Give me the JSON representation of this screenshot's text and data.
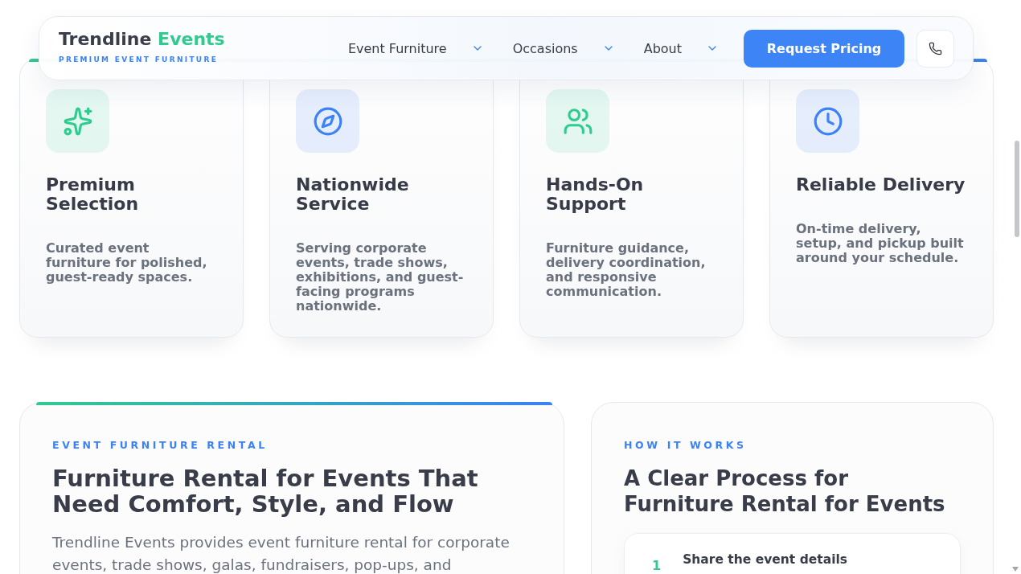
{
  "header": {
    "brand": {
      "name": "Trendline",
      "accent": "Events",
      "tagline": "PREMIUM EVENT FURNITURE"
    },
    "nav": [
      {
        "label": "Event Furniture"
      },
      {
        "label": "Occasions"
      },
      {
        "label": "About"
      }
    ],
    "cta": "Request Pricing"
  },
  "features": [
    {
      "color": "#2ecc8f",
      "title": "Premium Selection",
      "text": "Curated event furniture for polished, guest-ready spaces."
    },
    {
      "color": "#3b82f6",
      "title": "Nationwide Service",
      "text": "Serving corporate events, trade shows, exhibitions, and guest-facing programs nationwide."
    },
    {
      "color": "#2ecc8f",
      "title": "Hands-On Support",
      "text": "Furniture guidance, delivery coordination, and responsive communication."
    },
    {
      "color": "#3b82f6",
      "title": "Reliable Delivery",
      "text": "On-time delivery, setup, and pickup built around your schedule."
    }
  ],
  "intro": {
    "eyebrow": "EVENT FURNITURE RENTAL",
    "heading": "Furniture Rental for Events That Need Comfort, Style, and Flow",
    "body": "Trendline Events provides event furniture rental for corporate events, trade shows, galas, fundraisers, pop-ups, and"
  },
  "process": {
    "eyebrow": "HOW IT WORKS",
    "heading": "A Clear Process for Furniture Rental for Events",
    "steps": [
      {
        "number": "1",
        "title": "Share the event details"
      }
    ]
  }
}
